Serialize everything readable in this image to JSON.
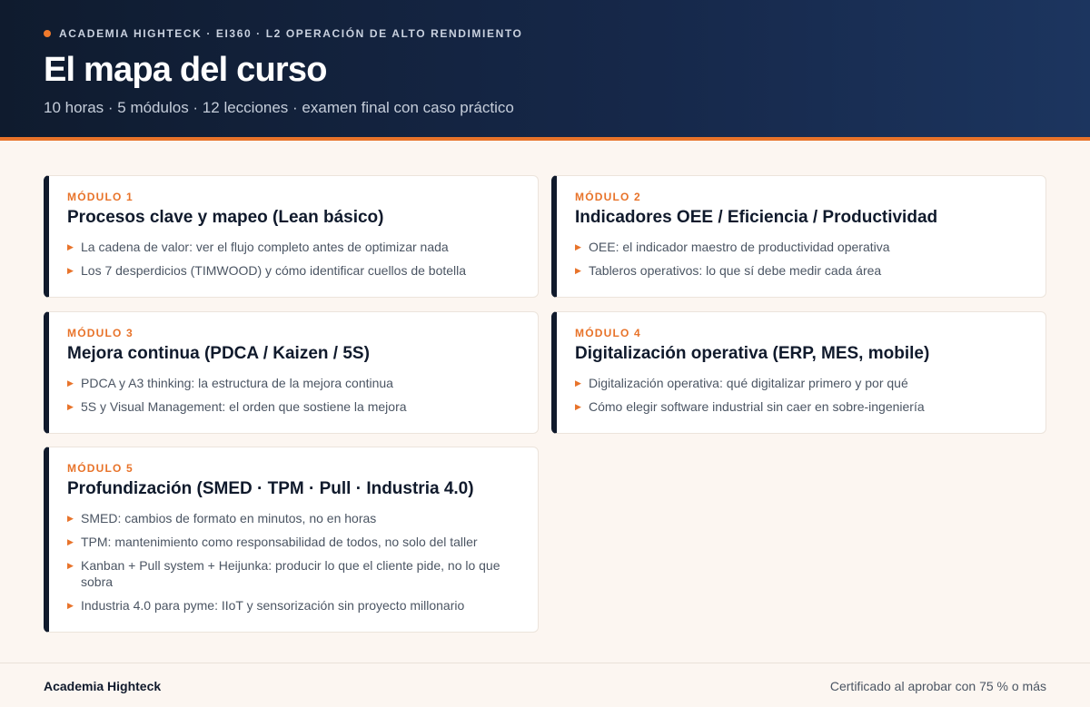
{
  "header": {
    "eyebrow": "ACADEMIA HIGHTECK · EI360 · L2 OPERACIÓN DE ALTO RENDIMIENTO",
    "title": "El mapa del curso",
    "subtitle": "10 horas · 5 módulos · 12 lecciones · examen final con caso práctico"
  },
  "modules": [
    {
      "label": "MÓDULO 1",
      "title": "Procesos clave y mapeo (Lean básico)",
      "lessons": [
        "La cadena de valor: ver el flujo completo antes de optimizar nada",
        "Los 7 desperdicios (TIMWOOD) y cómo identificar cuellos de botella"
      ]
    },
    {
      "label": "MÓDULO 2",
      "title": "Indicadores OEE / Eficiencia / Productividad",
      "lessons": [
        "OEE: el indicador maestro de productividad operativa",
        "Tableros operativos: lo que sí debe medir cada área"
      ]
    },
    {
      "label": "MÓDULO 3",
      "title": "Mejora continua (PDCA / Kaizen / 5S)",
      "lessons": [
        "PDCA y A3 thinking: la estructura de la mejora continua",
        "5S y Visual Management: el orden que sostiene la mejora"
      ]
    },
    {
      "label": "MÓDULO 4",
      "title": "Digitalización operativa (ERP, MES, mobile)",
      "lessons": [
        "Digitalización operativa: qué digitalizar primero y por qué",
        "Cómo elegir software industrial sin caer en sobre-ingeniería"
      ]
    },
    {
      "label": "MÓDULO 5",
      "title": "Profundización (SMED · TPM · Pull · Industria 4.0)",
      "lessons": [
        "SMED: cambios de formato en minutos, no en horas",
        "TPM: mantenimiento como responsabilidad de todos, no solo del taller",
        "Kanban + Pull system + Heijunka: producir lo que el cliente pide, no lo que sobra",
        "Industria 4.0 para pyme: IIoT y sensorización sin proyecto millonario"
      ]
    }
  ],
  "footer": {
    "brand": "Academia Highteck",
    "note": "Certificado al aprobar con 75 % o más"
  },
  "colors": {
    "accent": "#e8732a",
    "navy": "#101a2c",
    "background": "#fcf6f1"
  }
}
